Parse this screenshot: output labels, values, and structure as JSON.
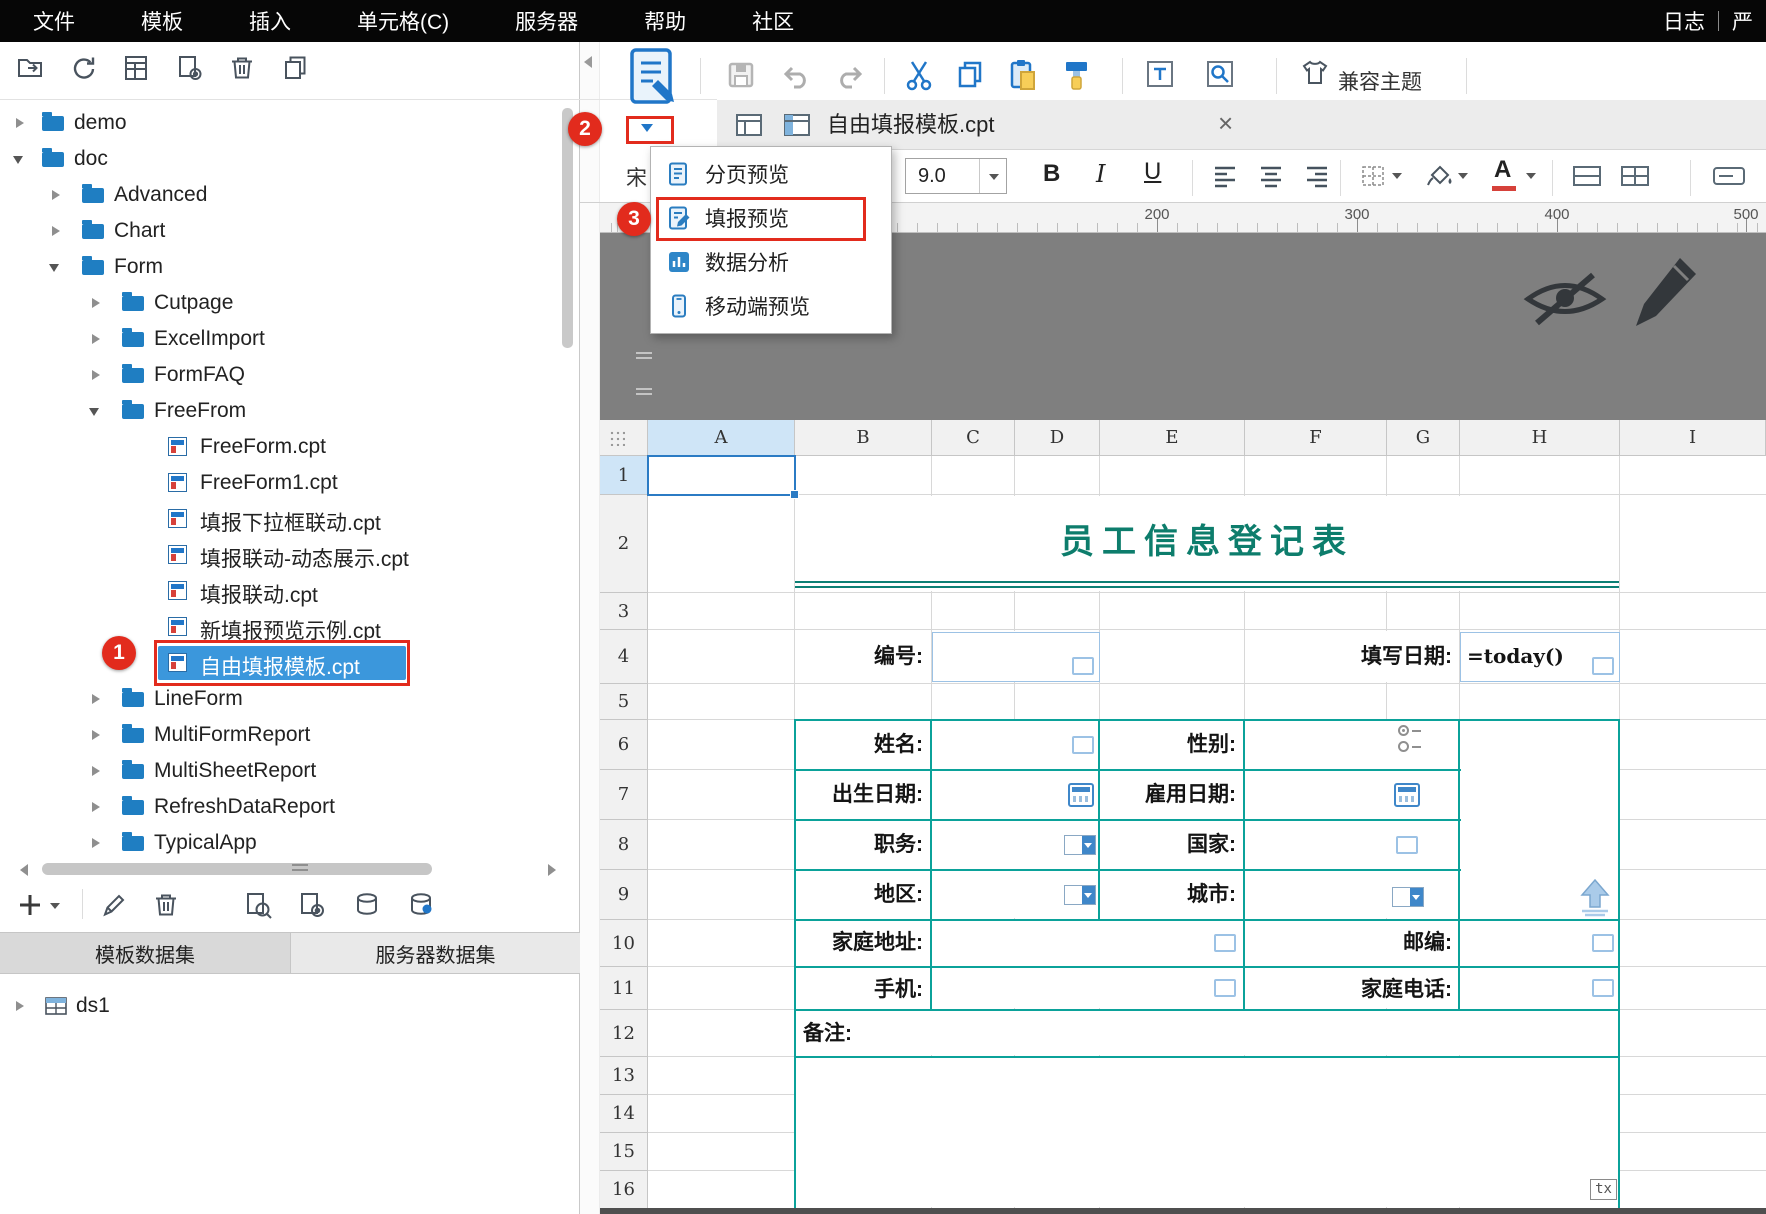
{
  "menu_bar": {
    "items": [
      "文件",
      "模板",
      "插入",
      "单元格(C)",
      "服务器",
      "帮助",
      "社区"
    ],
    "right_items": [
      "日志",
      "严"
    ]
  },
  "annotations": {
    "badge_1": "1",
    "badge_2": "2",
    "badge_3": "3"
  },
  "sidebar": {
    "tree": [
      {
        "label": "demo",
        "type": "folder",
        "state": "collapsed",
        "level": 0
      },
      {
        "label": "doc",
        "type": "folder",
        "state": "expanded",
        "level": 0
      },
      {
        "label": "Advanced",
        "type": "folder",
        "state": "collapsed",
        "level": 1
      },
      {
        "label": "Chart",
        "type": "folder",
        "state": "collapsed",
        "level": 1
      },
      {
        "label": "Form",
        "type": "folder",
        "state": "expanded",
        "level": 1
      },
      {
        "label": "Cutpage",
        "type": "folder",
        "state": "collapsed",
        "level": 2
      },
      {
        "label": "ExcelImport",
        "type": "folder",
        "state": "collapsed",
        "level": 2
      },
      {
        "label": "FormFAQ",
        "type": "folder",
        "state": "collapsed",
        "level": 2
      },
      {
        "label": "FreeFrom",
        "type": "folder",
        "state": "expanded",
        "level": 2
      },
      {
        "label": "FreeForm.cpt",
        "type": "file",
        "level": 3
      },
      {
        "label": "FreeForm1.cpt",
        "type": "file",
        "level": 3
      },
      {
        "label": "填报下拉框联动.cpt",
        "type": "file",
        "level": 3
      },
      {
        "label": "填报联动-动态展示.cpt",
        "type": "file",
        "level": 3
      },
      {
        "label": "填报联动.cpt",
        "type": "file",
        "level": 3
      },
      {
        "label": "新填报预览示例.cpt",
        "type": "file",
        "level": 3
      },
      {
        "label": "自由填报模板.cpt",
        "type": "file",
        "level": 3,
        "selected": true
      },
      {
        "label": "LineForm",
        "type": "folder",
        "state": "collapsed",
        "level": 2
      },
      {
        "label": "MultiFormReport",
        "type": "folder",
        "state": "collapsed",
        "level": 2
      },
      {
        "label": "MultiSheetReport",
        "type": "folder",
        "state": "collapsed",
        "level": 2
      },
      {
        "label": "RefreshDataReport",
        "type": "folder",
        "state": "collapsed",
        "level": 2
      },
      {
        "label": "TypicalApp",
        "type": "folder",
        "state": "collapsed",
        "level": 2
      }
    ],
    "dataset_tabs": [
      "模板数据集",
      "服务器数据集"
    ],
    "datasets": [
      {
        "label": "ds1"
      }
    ]
  },
  "toolbar": {
    "compat_theme": "兼容主题"
  },
  "preview_menu": {
    "items": [
      "分页预览",
      "填报预览",
      "数据分析",
      "移动端预览"
    ]
  },
  "document_tab": {
    "title": "自由填报模板.cpt",
    "close": "×"
  },
  "format_toolbar": {
    "font_name_partial": "宋",
    "font_size": "9.0",
    "bold": "B",
    "italic": "I",
    "underline": "U",
    "font_color_letter": "A"
  },
  "ruler": {
    "labels": [
      "200",
      "300",
      "400",
      "500"
    ]
  },
  "spreadsheet": {
    "column_headers": [
      "A",
      "B",
      "C",
      "D",
      "E",
      "F",
      "G",
      "H",
      "I"
    ],
    "row_headers": [
      "1",
      "2",
      "3",
      "4",
      "5",
      "6",
      "7",
      "8",
      "9",
      "10",
      "11",
      "12",
      "13",
      "14",
      "15",
      "16"
    ],
    "form": {
      "title": "员工信息登记表",
      "no_label": "编号:",
      "fill_date_label": "填写日期:",
      "fill_date_formula": "=today()",
      "name_label": "姓名:",
      "gender_label": "性别:",
      "birth_label": "出生日期:",
      "hire_label": "雇用日期:",
      "job_label": "职务:",
      "country_label": "国家:",
      "region_label": "地区:",
      "city_label": "城市:",
      "address_label": "家庭地址:",
      "zip_label": "邮编:",
      "mobile_label": "手机:",
      "home_phone_label": "家庭电话:",
      "remark_label": "备注:",
      "textarea_badge": "tx"
    }
  },
  "colors": {
    "accent_blue": "#2076c8",
    "annotation_red": "#e22b1d",
    "form_border_teal": "#0ba29a",
    "title_teal": "#0d7d6c",
    "selection_blue": "#3b97dc"
  }
}
